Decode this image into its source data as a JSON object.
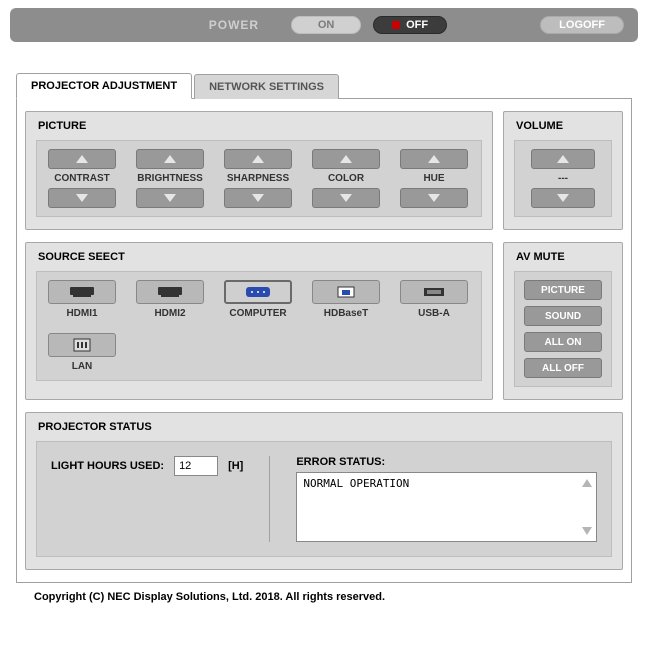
{
  "topbar": {
    "power_label": "POWER",
    "on_label": "ON",
    "off_label": "OFF",
    "logoff_label": "LOGOFF"
  },
  "tabs": {
    "adjustment": "PROJECTOR ADJUSTMENT",
    "network": "NETWORK SETTINGS"
  },
  "picture": {
    "title": "PICTURE",
    "items": [
      "CONTRAST",
      "BRIGHTNESS",
      "SHARPNESS",
      "COLOR",
      "HUE"
    ]
  },
  "volume": {
    "title": "VOLUME",
    "value": "---"
  },
  "source": {
    "title": "SOURCE SEECT",
    "items": [
      "HDMI1",
      "HDMI2",
      "COMPUTER",
      "HDBaseT",
      "USB-A",
      "LAN"
    ]
  },
  "avmute": {
    "title": "AV MUTE",
    "buttons": [
      "PICTURE",
      "SOUND",
      "ALL ON",
      "ALL OFF"
    ]
  },
  "status": {
    "title": "PROJECTOR STATUS",
    "light_label": "LIGHT HOURS USED:",
    "light_value": "12",
    "light_unit": "[H]",
    "error_label": "ERROR STATUS:",
    "error_text": "NORMAL OPERATION"
  },
  "copyright": "Copyright (C) NEC Display Solutions, Ltd. 2018. All rights reserved."
}
